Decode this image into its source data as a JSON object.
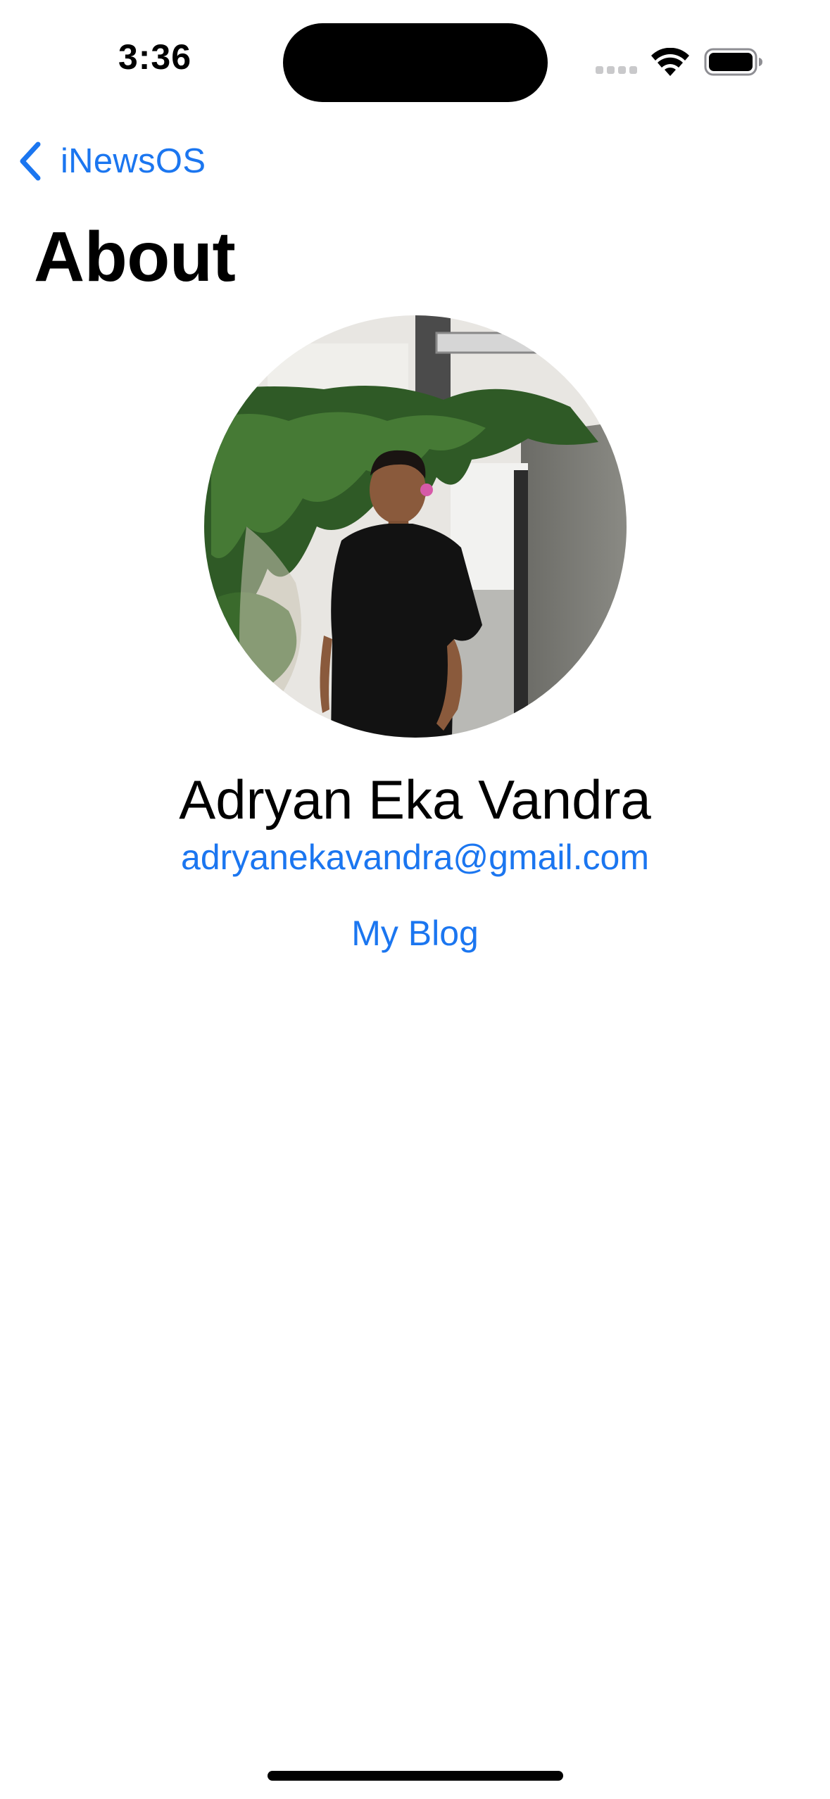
{
  "status_bar": {
    "time": "3:36",
    "icons": [
      "cellular-signal-icon",
      "wifi-icon",
      "battery-icon"
    ]
  },
  "navigation": {
    "back_label": "iNewsOS",
    "back_icon": "chevron-left-icon",
    "title": "About"
  },
  "profile": {
    "photo": "profile-photo",
    "name": "Adryan Eka Vandra",
    "email": "adryanekavandra@gmail.com",
    "blog_link": "My Blog"
  },
  "colors": {
    "accent": "#1b76f0",
    "text": "#000000",
    "background": "#ffffff"
  }
}
